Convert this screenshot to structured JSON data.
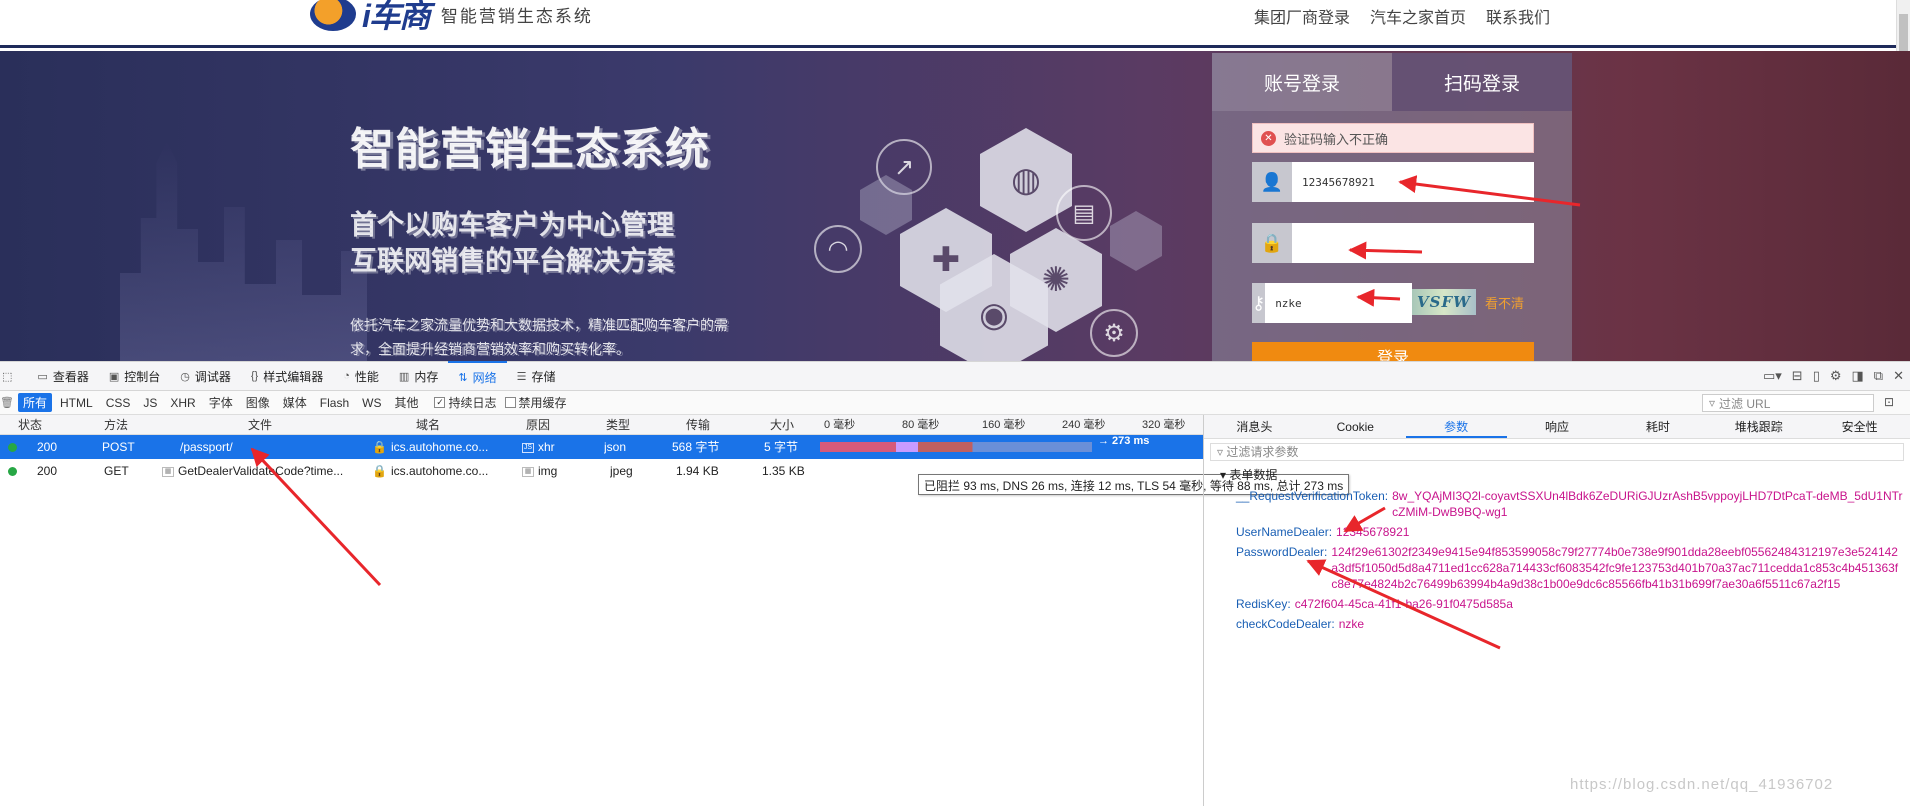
{
  "site": {
    "logo_text": "i车商",
    "slogan": "智能营销生态系统",
    "nav": [
      "集团厂商登录",
      "汽车之家首页",
      "联系我们"
    ]
  },
  "banner": {
    "title": "智能营销生态系统",
    "subtitle_1": "首个以购车客户为中心管理",
    "subtitle_2": "互联网销售的平台解决方案",
    "description": "依托汽车之家流量优势和大数据技术，精准匹配购车客户的需求，全面提升经销商营销效率和购买转化率。"
  },
  "login": {
    "tab_account": "账号登录",
    "tab_qr": "扫码登录",
    "error": "验证码输入不正确",
    "username_value": "12345678921",
    "password_value": "",
    "captcha_value": "nzke",
    "captcha_image_text": "VSFW",
    "captcha_refresh": "看不清",
    "submit": "登录"
  },
  "devtools": {
    "tabs": [
      {
        "icon": "▭",
        "label": "查看器"
      },
      {
        "icon": "▣",
        "label": "控制台"
      },
      {
        "icon": "◷",
        "label": "调试器"
      },
      {
        "icon": "{}",
        "label": "样式编辑器"
      },
      {
        "icon": "◔",
        "label": "性能"
      },
      {
        "icon": "▥",
        "label": "内存"
      },
      {
        "icon": "⇅",
        "label": "网络"
      },
      {
        "icon": "☰",
        "label": "存储"
      }
    ],
    "filter_types": [
      "所有",
      "HTML",
      "CSS",
      "JS",
      "XHR",
      "字体",
      "图像",
      "媒体",
      "Flash",
      "WS",
      "其他"
    ],
    "persist_log": "持续日志",
    "disable_cache": "禁用缓存",
    "url_filter_placeholder": "过滤 URL",
    "columns": [
      "状态",
      "方法",
      "文件",
      "域名",
      "原因",
      "类型",
      "传输",
      "大小"
    ],
    "timeline_ticks": [
      "0 毫秒",
      "80 毫秒",
      "160 毫秒",
      "240 毫秒",
      "320 毫秒"
    ],
    "requests": [
      {
        "status": "200",
        "method": "POST",
        "file": "/passport/",
        "domain": "ics.autohome.co...",
        "cause": "xhr",
        "type": "json",
        "transferred": "568 字节",
        "size": "5 字节",
        "timing": "→ 273 ms"
      },
      {
        "status": "200",
        "method": "GET",
        "file": "GetDealerValidateCode?time...",
        "domain": "ics.autohome.co...",
        "cause": "img",
        "type": "jpeg",
        "transferred": "1.94 KB",
        "size": "1.35 KB",
        "timing": ""
      }
    ],
    "timing_tooltip": "已阻拦 93 ms, DNS 26 ms, 连接 12 ms, TLS 54 毫秒, 等待 88 ms, 总计 273 ms",
    "detail_tabs": [
      "消息头",
      "Cookie",
      "参数",
      "响应",
      "耗时",
      "堆栈跟踪",
      "安全性"
    ],
    "param_filter_placeholder": "过滤请求参数",
    "form_data_title": "表单数据",
    "params": [
      {
        "key": "__RequestVerificationToken:",
        "value": "8w_YQAjMI3Q2l-coyavtSSXUn4lBdk6ZeDURiGJUzrAshB5vppoyjLHD7DtPcaT-deMB_5dU1NTrcZMiM-DwB9BQ-wg1"
      },
      {
        "key": "UserNameDealer:",
        "value": "12345678921"
      },
      {
        "key": "PasswordDealer:",
        "value": "124f29e61302f2349e9415e94f853599058c79f27774b0e738e9f901dda28eebf05562484312197e3e524142a3df5f1050d5d8a4711ed1cc628a714433cf6083542fc9fe123753d401b70a37ac711cedda1c853c4b451363fc8e77e4824b2c76499b63994b4a9d38c1b00e9dc6c85566fb41b31b699f7ae30a6f5511c67a2f15"
      },
      {
        "key": "RedisKey:",
        "value": "c472f604-45ca-41f1-ba26-91f0475d585a"
      },
      {
        "key": "checkCodeDealer:",
        "value": "nzke"
      }
    ]
  },
  "watermark": "https://blog.csdn.net/qq_41936702",
  "colors": {
    "accent": "#1a73e8",
    "param_key": "#1a5fb4",
    "param_value": "#c8148c",
    "login_button": "#f08a10",
    "annotation": "#e8262b"
  }
}
